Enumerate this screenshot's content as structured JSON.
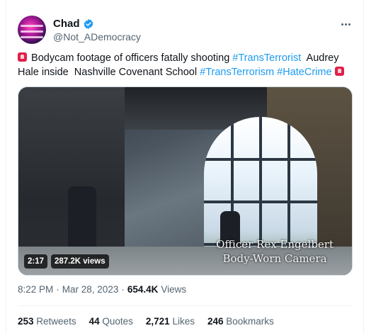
{
  "author": {
    "display_name": "Chad",
    "handle": "@Not_ADemocracy",
    "verified": true,
    "accent_color": "#1d9bf0"
  },
  "tweet": {
    "segments": [
      {
        "type": "emoji",
        "name": "police-light-emoji"
      },
      {
        "type": "text",
        "value": " Bodycam footage of officers fatally shooting "
      },
      {
        "type": "hashtag",
        "value": "#TransTerrorist"
      },
      {
        "type": "text",
        "value": "  Audrey Hale inside  Nashville Covenant School "
      },
      {
        "type": "hashtag",
        "value": "#TransTerrorism"
      },
      {
        "type": "text",
        "value": " "
      },
      {
        "type": "hashtag",
        "value": "#HateCrime"
      },
      {
        "type": "text",
        "value": " "
      },
      {
        "type": "emoji",
        "name": "police-light-emoji"
      }
    ]
  },
  "media": {
    "overlay_line1": "Officer Rex Engelbert",
    "overlay_line2": "Body-Worn Camera",
    "duration": "2:17",
    "views": "287.2K views"
  },
  "meta": {
    "time": "8:22 PM",
    "separator": "·",
    "date": "Mar 28, 2023",
    "views_count": "654.4K",
    "views_label": "Views"
  },
  "stats": [
    {
      "count": "253",
      "label": "Retweets"
    },
    {
      "count": "44",
      "label": "Quotes"
    },
    {
      "count": "2,721",
      "label": "Likes"
    },
    {
      "count": "246",
      "label": "Bookmarks"
    }
  ]
}
